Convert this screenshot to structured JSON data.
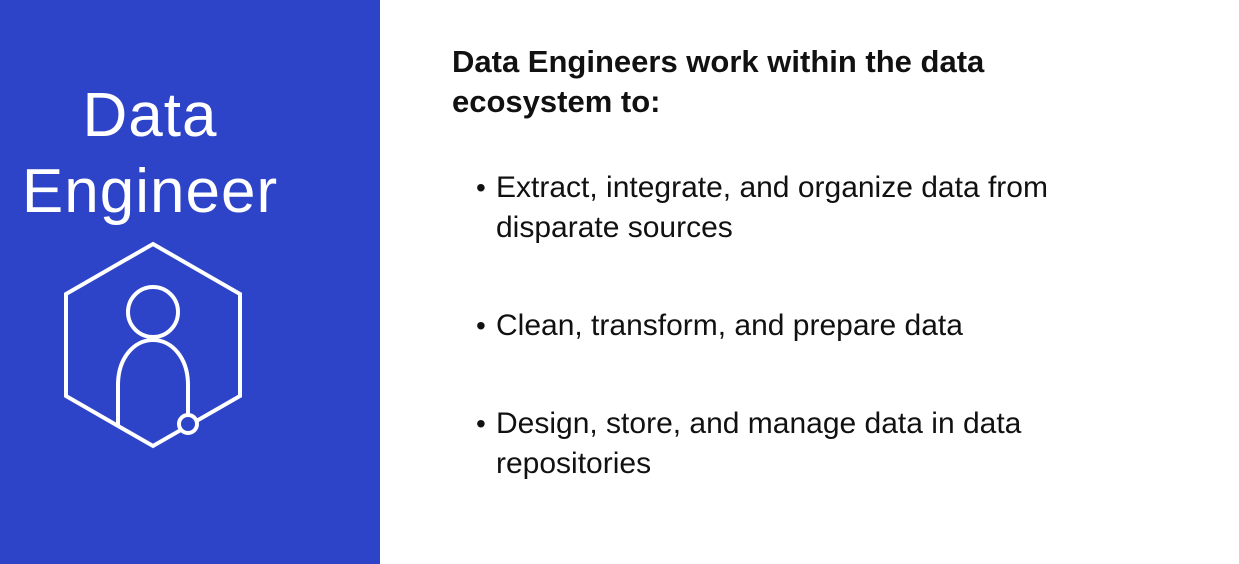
{
  "left_panel": {
    "title_line_1": "Data",
    "title_line_2": "Engineer",
    "background_color": "#2e44c8",
    "icon": "user-hexagon-icon"
  },
  "content": {
    "heading": "Data Engineers work within the data ecosystem to:",
    "bullet_symbol": "•",
    "bullets": [
      {
        "text": "Extract, integrate, and organize data from disparate sources"
      },
      {
        "text": "Clean, transform, and prepare data"
      },
      {
        "text": "Design, store, and manage data in data repositories"
      }
    ]
  }
}
